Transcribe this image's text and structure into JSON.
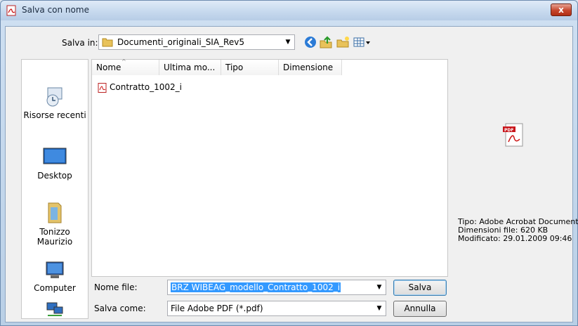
{
  "window": {
    "title": "Salva con nome",
    "close_label": "x"
  },
  "toolbar": {
    "save_in_label": "Salva in:",
    "save_in_folder": "Documenti_originali_SIA_Rev5",
    "buttons": [
      "back-icon",
      "up-folder-icon",
      "new-folder-icon",
      "views-menu-icon"
    ]
  },
  "places": [
    {
      "label": "Risorse recenti",
      "icon": "recent-places-icon"
    },
    {
      "label": "Desktop",
      "icon": "desktop-icon"
    },
    {
      "label": "Tonizzo Maurizio",
      "icon": "user-folder-icon"
    },
    {
      "label": "Computer",
      "icon": "computer-icon"
    },
    {
      "label": "",
      "icon": "network-icon"
    }
  ],
  "file_list": {
    "columns": [
      "Nome",
      "Ultima mo...",
      "Tipo",
      "Dimensione"
    ],
    "sort_column": "Nome",
    "files": [
      {
        "name": "Contratto_1002_i",
        "icon": "pdf-icon"
      }
    ]
  },
  "preview": {
    "type": "Tipo: Adobe Acrobat Document",
    "size": "Dimensioni file: 620 KB",
    "modified": "Modificato: 29.01.2009 09:46",
    "icon": "pdf-large-icon"
  },
  "form": {
    "filename_label": "Nome file:",
    "filename_value": "BRZ WIBEAG_modello_Contratto_1002_i",
    "save_as_label": "Salva come:",
    "save_as_value": "File Adobe PDF (*.pdf)",
    "save_button": "Salva",
    "cancel_button": "Annulla"
  },
  "colors": {
    "selection": "#3399ff",
    "title_gradient_top": "#dfeaf7",
    "close_red": "#c6472d"
  }
}
